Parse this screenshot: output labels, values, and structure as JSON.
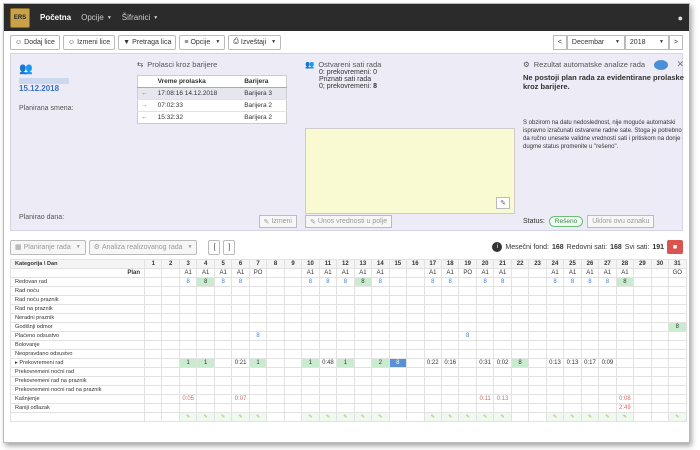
{
  "nav": {
    "brand": "ERS",
    "items": [
      {
        "label": "Početna",
        "active": true,
        "caret": false
      },
      {
        "label": "Opcije",
        "active": false,
        "caret": true
      },
      {
        "label": "Šifranici",
        "active": false,
        "caret": true
      }
    ]
  },
  "toolbar": {
    "add_person": "Dodaj lice",
    "edit_person": "Izmeni lice",
    "search_person": "Pretraga lica",
    "options": "Opcije",
    "reports": "Izveštaji",
    "prev": "<",
    "month": "Decembar",
    "year": "2018",
    "next": ">"
  },
  "panel": {
    "person_date": "15.12.2018",
    "planned_shift_label": "Planirana smena:",
    "planned_by_label": "Planirao dana:",
    "edit_btn": "Izmeni",
    "barriers": {
      "title": "Prolasci kroz barijere",
      "col_time": "Vreme prolaska",
      "col_barrier": "Barijera",
      "rows": [
        {
          "time": "17:08:16 14.12.2018",
          "barrier": "Barijera 3",
          "dir": "in"
        },
        {
          "time": "07:02:33",
          "barrier": "Barijera 2",
          "dir": "out"
        },
        {
          "time": "15:32:32",
          "barrier": "Barijera 2",
          "dir": "in"
        }
      ]
    },
    "hours": {
      "title": "Ostvareni sati rada",
      "overtime_label": "0: prekovremeni: 0",
      "recognized_title": "Priznati sati rada",
      "recognized_label": "0; prekovremeni:",
      "recognized_value": "8",
      "enter_btn": "Unos vrednosti u polje"
    },
    "analysis": {
      "title": "Rezultat automatske analize rada",
      "heading": "Ne postoji plan rada za evidentirane prolaske kroz barijere.",
      "body": "S obzirom na datu nedoslednost, nije moguće automatski ispravno izračunati ostvarene radne sate. Stoga je potrebno da ručno unesete validne vrednosti sati i pritiskom na donje dugme status promenite u \"rešeno\".",
      "status_label": "Status:",
      "status_value": "Rešeno",
      "remove_btn": "Ukloni ovu oznaku"
    }
  },
  "second_bar": {
    "plan_btn": "Planiranje rada",
    "analysis_btn": "Analiza realizovanog rada",
    "monthly_fund_label": "Mesečni fond:",
    "monthly_fund_value": "168",
    "regular_label": "Redovni sati:",
    "regular_value": "168",
    "total_label": "Svi sati:",
    "total_value": "191"
  },
  "grid": {
    "header_label": "Kategorija \\ Dan",
    "plan_label": "Plan",
    "days": [
      "1",
      "2",
      "3",
      "4",
      "5",
      "6",
      "7",
      "8",
      "9",
      "10",
      "11",
      "12",
      "13",
      "14",
      "15",
      "16",
      "17",
      "18",
      "19",
      "20",
      "21",
      "22",
      "23",
      "24",
      "25",
      "26",
      "27",
      "28",
      "29",
      "30",
      "31"
    ],
    "plan": [
      "",
      "",
      "A1",
      "A1",
      "A1",
      "A1",
      "PO",
      "",
      "",
      "A1",
      "A1",
      "A1",
      "A1",
      "A1",
      "",
      "",
      "A1",
      "A1",
      "PO",
      "A1",
      "A1",
      "",
      "",
      "A1",
      "A1",
      "A1",
      "A1",
      "A1",
      "",
      "",
      "GO"
    ],
    "categories": [
      {
        "name": "Redovan rad",
        "values": [
          "",
          "",
          "8",
          "8",
          "8",
          "8",
          "",
          "",
          "",
          "8",
          "8",
          "8",
          "8",
          "8",
          "",
          "",
          "8",
          "8",
          "",
          "8",
          "8",
          "",
          "",
          "8",
          "8",
          "8",
          "8",
          "8",
          "",
          "",
          ""
        ],
        "style": "blue"
      },
      {
        "name": "Rad noću",
        "values": [],
        "style": ""
      },
      {
        "name": "Rad noću praznik",
        "values": [],
        "style": ""
      },
      {
        "name": "Rad na praznik",
        "values": [],
        "style": ""
      },
      {
        "name": "Neradni praznik",
        "values": [],
        "style": ""
      },
      {
        "name": "Godišnji odmor",
        "values": [
          "",
          "",
          "",
          "",
          "",
          "",
          "",
          "",
          "",
          "",
          "",
          "",
          "",
          "",
          "",
          "",
          "",
          "",
          "",
          "",
          "",
          "",
          "",
          "",
          "",
          "",
          "",
          "",
          "",
          "",
          "8"
        ],
        "style": "green"
      },
      {
        "name": "Plaćeno odsustvo",
        "values": [
          "",
          "",
          "",
          "",
          "",
          "",
          "8",
          "",
          "",
          "",
          "",
          "",
          "",
          "",
          "",
          "",
          "",
          "",
          "8",
          "",
          "",
          "",
          "",
          "",
          "",
          "",
          "",
          "",
          "",
          "",
          ""
        ],
        "style": "blue"
      },
      {
        "name": "Bolovanje",
        "values": [],
        "style": ""
      },
      {
        "name": "Neopravdano odsustvo",
        "values": [],
        "style": ""
      },
      {
        "name": "Prekovremeni rad",
        "values": [
          "",
          "",
          "1",
          "1",
          "",
          "0:21",
          "1",
          "",
          "",
          "1",
          "0:48",
          "1",
          "",
          "2",
          "8",
          "",
          "0:22",
          "0:16",
          "",
          "0:31",
          "0:02",
          "8",
          "",
          "0:13",
          "0:13",
          "0:17",
          "0:09",
          "",
          "",
          "",
          ""
        ],
        "style": "ot"
      },
      {
        "name": "Prekovremeni noćni rad",
        "values": [],
        "style": ""
      },
      {
        "name": "Prekovremeni rad na praznik",
        "values": [],
        "style": ""
      },
      {
        "name": "Prekovremeni noćni rad na praznik",
        "values": [],
        "style": ""
      },
      {
        "name": "Kašnjenje",
        "values": [
          "",
          "",
          "0:05",
          "",
          "",
          "0:07",
          "",
          "",
          "",
          "",
          "",
          "",
          "",
          "",
          "",
          "",
          "",
          "",
          "",
          "0:11",
          "0:13",
          "",
          "",
          "",
          "",
          "",
          "",
          "0:08",
          "",
          "",
          ""
        ],
        "style": "red"
      },
      {
        "name": "Raniji odlazak",
        "values": [
          "",
          "",
          "",
          "",
          "",
          "",
          "",
          "",
          "",
          "",
          "",
          "",
          "",
          "",
          "",
          "",
          "",
          "",
          "",
          "",
          "",
          "",
          "",
          "",
          "",
          "",
          "",
          "2:49",
          "",
          "",
          ""
        ],
        "style": "red"
      }
    ]
  }
}
